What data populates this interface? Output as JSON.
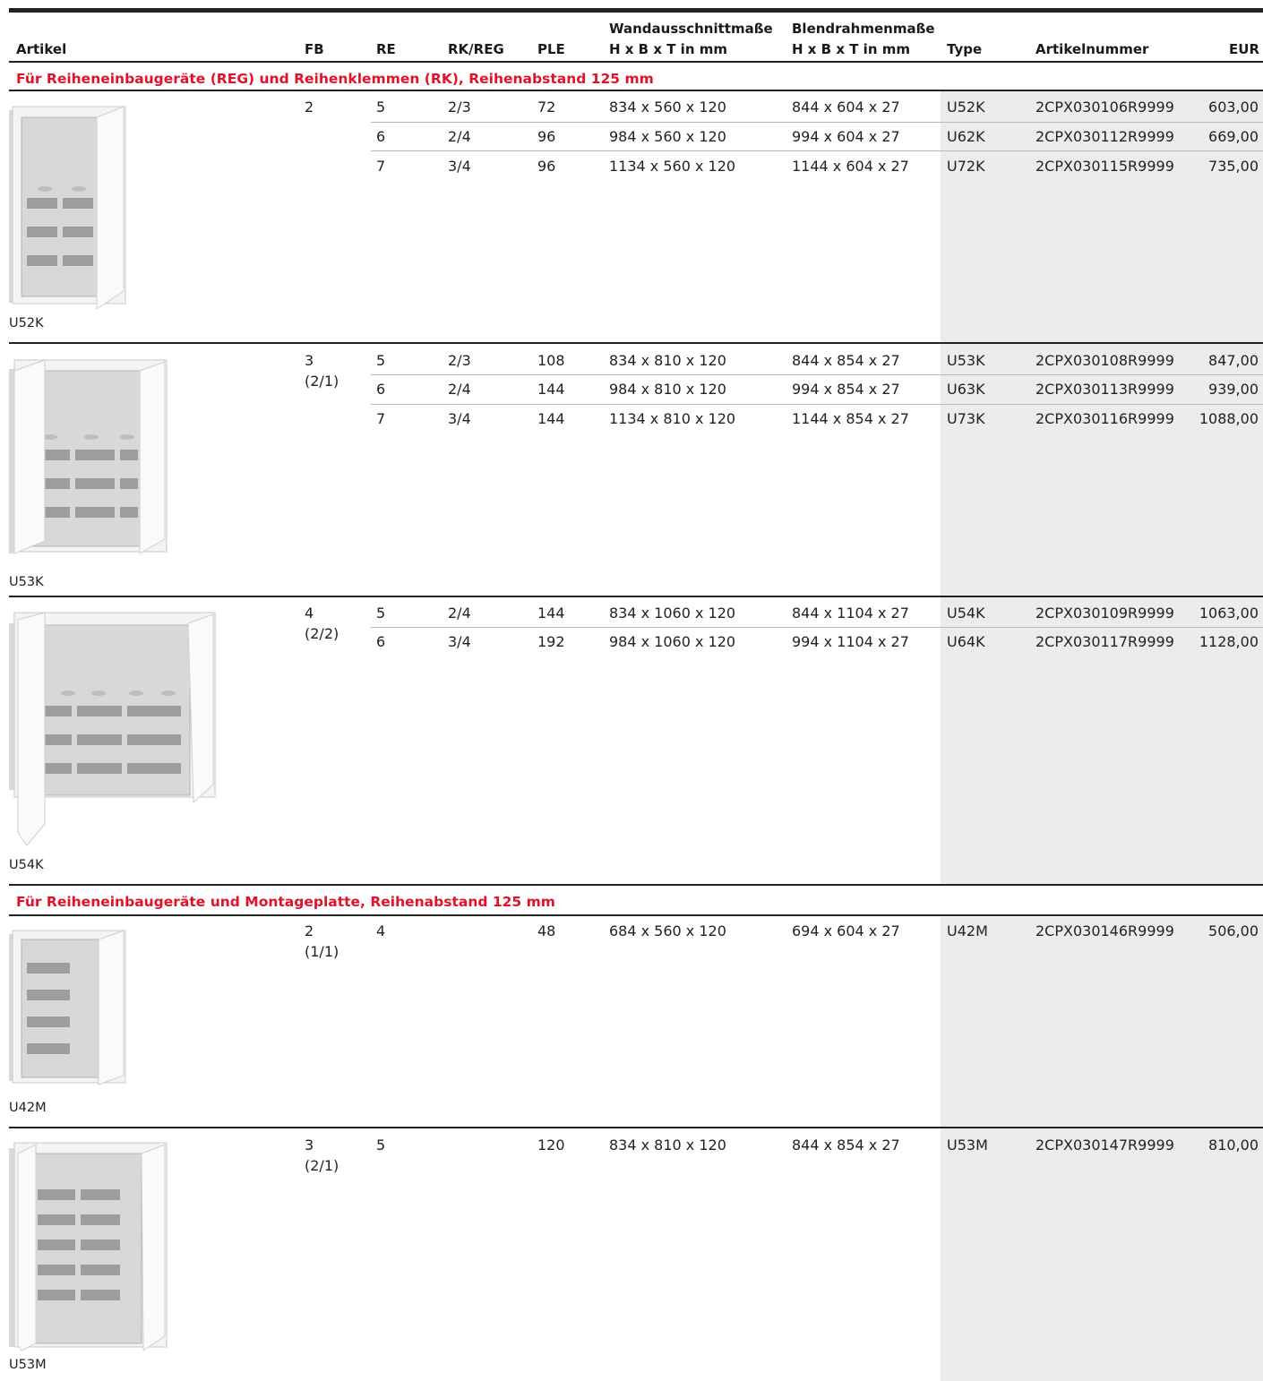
{
  "header": {
    "artikel": "Artikel",
    "fb": "FB",
    "re": "RE",
    "rkreg": "RK/REG",
    "ple": "PLE",
    "wand_title": "Wandausschnittmaße",
    "wand_sub": "H x B x T in mm",
    "blend_title": "Blendrahmenmaße",
    "blend_sub": "H x B x T in mm",
    "type": "Type",
    "artnr": "Artikelnummer",
    "eur": "EUR"
  },
  "sections": [
    {
      "title": "Für Reiheneinbaugeräte (REG) und Reihenklemmen (RK), Reihenabstand 125 mm",
      "products": [
        {
          "caption": "U52K",
          "image_icon": "distribution-cabinet-2-field-image",
          "fb": "2",
          "fb_sub": "",
          "rows": [
            {
              "re": "5",
              "rkreg": "2/3",
              "ple": "72",
              "wand": "834 x 560 x 120",
              "blend": "844 x 604 x 27",
              "type": "U52K",
              "artnr": "2CPX030106R9999",
              "eur": "603,00"
            },
            {
              "re": "6",
              "rkreg": "2/4",
              "ple": "96",
              "wand": "984 x 560 x 120",
              "blend": "994 x 604 x 27",
              "type": "U62K",
              "artnr": "2CPX030112R9999",
              "eur": "669,00"
            },
            {
              "re": "7",
              "rkreg": "3/4",
              "ple": "96",
              "wand": "1134 x 560 x 120",
              "blend": "1144 x 604 x 27",
              "type": "U72K",
              "artnr": "2CPX030115R9999",
              "eur": "735,00"
            }
          ]
        },
        {
          "caption": "U53K",
          "image_icon": "distribution-cabinet-3-field-image",
          "fb": "3",
          "fb_sub": "(2/1)",
          "rows": [
            {
              "re": "5",
              "rkreg": "2/3",
              "ple": "108",
              "wand": "834 x 810 x 120",
              "blend": "844 x 854 x 27",
              "type": "U53K",
              "artnr": "2CPX030108R9999",
              "eur": "847,00"
            },
            {
              "re": "6",
              "rkreg": "2/4",
              "ple": "144",
              "wand": "984 x 810 x 120",
              "blend": "994 x 854 x 27",
              "type": "U63K",
              "artnr": "2CPX030113R9999",
              "eur": "939,00"
            },
            {
              "re": "7",
              "rkreg": "3/4",
              "ple": "144",
              "wand": "1134 x 810 x 120",
              "blend": "1144 x 854 x 27",
              "type": "U73K",
              "artnr": "2CPX030116R9999",
              "eur": "1088,00"
            }
          ]
        },
        {
          "caption": "U54K",
          "image_icon": "distribution-cabinet-4-field-image",
          "fb": "4",
          "fb_sub": "(2/2)",
          "rows": [
            {
              "re": "5",
              "rkreg": "2/4",
              "ple": "144",
              "wand": "834 x 1060 x 120",
              "blend": "844 x 1104 x 27",
              "type": "U54K",
              "artnr": "2CPX030109R9999",
              "eur": "1063,00"
            },
            {
              "re": "6",
              "rkreg": "3/4",
              "ple": "192",
              "wand": "984 x 1060 x 120",
              "blend": "994 x 1104 x 27",
              "type": "U64K",
              "artnr": "2CPX030117R9999",
              "eur": "1128,00"
            }
          ]
        }
      ]
    },
    {
      "title": "Für Reiheneinbaugeräte und Montageplatte, Reihenabstand 125 mm",
      "products": [
        {
          "caption": "U42M",
          "image_icon": "distribution-cabinet-2-field-mounting-plate-image",
          "fb": "2",
          "fb_sub": "(1/1)",
          "rows": [
            {
              "re": "4",
              "rkreg": "",
              "ple": "48",
              "wand": "684 x 560 x 120",
              "blend": "694 x 604 x 27",
              "type": "U42M",
              "artnr": "2CPX030146R9999",
              "eur": "506,00"
            }
          ]
        },
        {
          "caption": "U53M",
          "image_icon": "distribution-cabinet-3-field-mounting-plate-image",
          "fb": "3",
          "fb_sub": "(2/1)",
          "rows": [
            {
              "re": "5",
              "rkreg": "",
              "ple": "120",
              "wand": "834 x 810 x 120",
              "blend": "844 x 854 x 27",
              "type": "U53M",
              "artnr": "2CPX030147R9999",
              "eur": "810,00"
            }
          ]
        }
      ]
    }
  ],
  "colors": {
    "accent_red": "#e3122b",
    "type_column_shade": "#ececec",
    "rule": "#222222"
  }
}
